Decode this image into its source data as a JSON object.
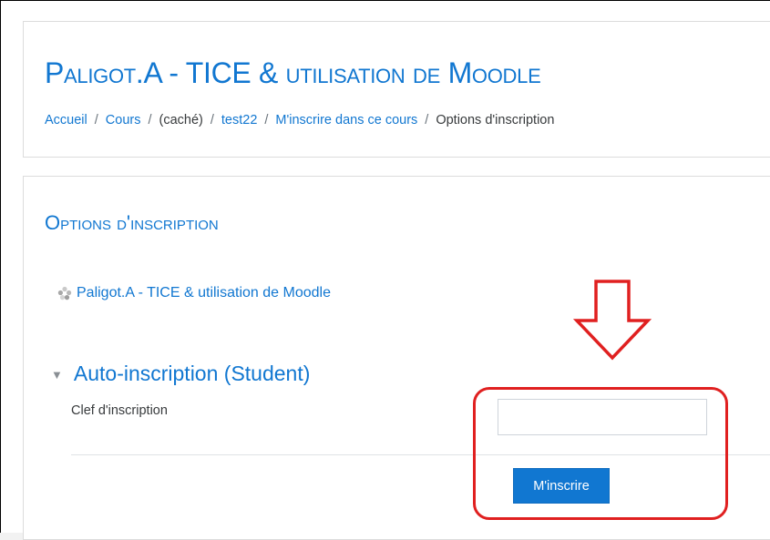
{
  "header": {
    "site_title": "Paligot.A - TICE & utilisation de Moodle",
    "breadcrumb": [
      {
        "label": "Accueil",
        "link": true
      },
      {
        "label": "Cours",
        "link": true
      },
      {
        "label": "(caché)",
        "link": false
      },
      {
        "label": "test22",
        "link": true
      },
      {
        "label": "M'inscrire dans ce cours",
        "link": true
      },
      {
        "label": "Options d'inscription",
        "link": false
      }
    ],
    "separator": "/"
  },
  "main": {
    "heading": "Options d'inscription",
    "course_link": "Paligot.A - TICE & utilisation de Moodle",
    "course_icon": "course-icon",
    "section": {
      "title": "Auto-inscription (Student)",
      "caret_icon": "caret-down-icon",
      "field_label": "Clef d'inscription",
      "input_value": "",
      "submit_label": "M'inscrire"
    }
  },
  "annotation": {
    "arrow_icon": "down-arrow-icon",
    "color": "#e02020"
  },
  "colors": {
    "accent": "#1177d1",
    "text": "#373a3c"
  }
}
